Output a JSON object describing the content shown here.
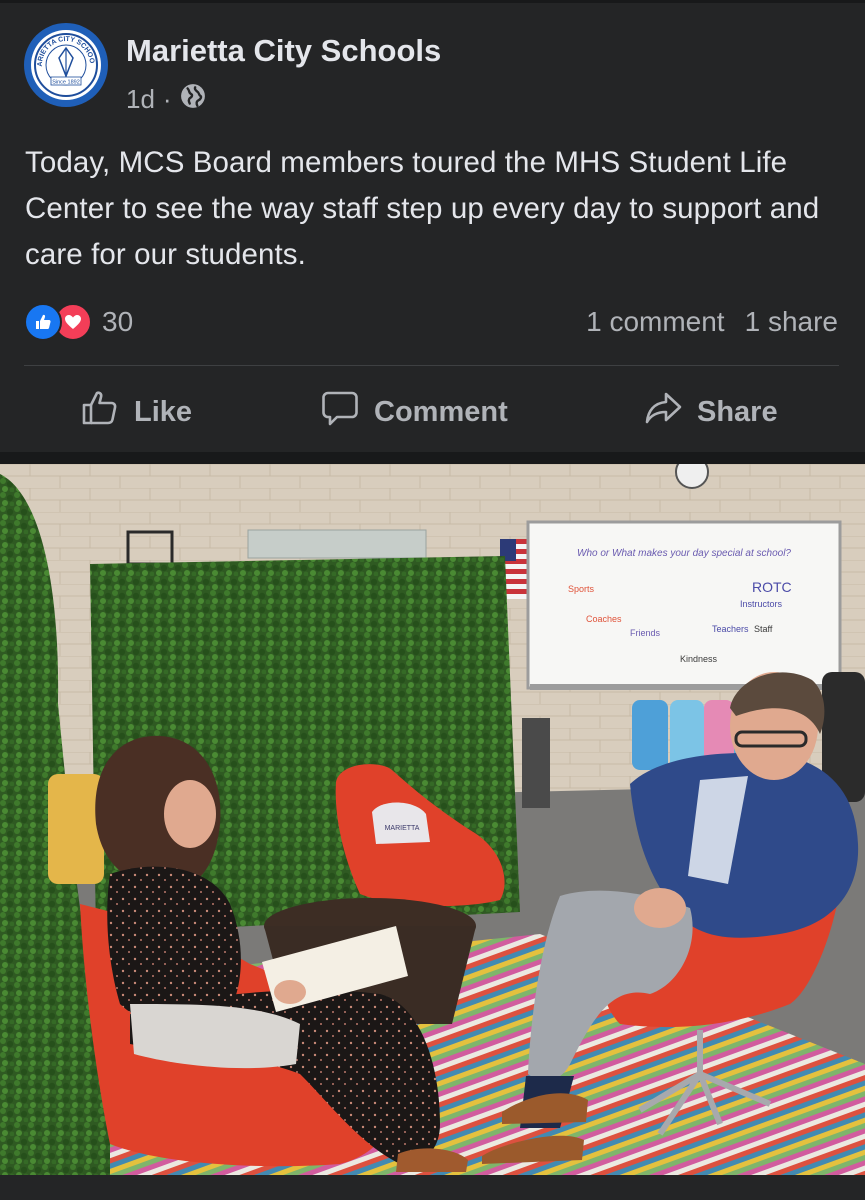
{
  "post": {
    "page_name": "Marietta City Schools",
    "time": "1d",
    "audience_icon": "globe-icon",
    "text": "Today, MCS Board members toured the MHS Student Life Center to see the way staff step up every day to support and care for our students.",
    "avatar": {
      "seal_text_top": "MARIETTA CITY SCHOOLS",
      "seal_text_bottom": "Since 1892"
    },
    "reactions": {
      "icons": [
        "like-icon",
        "love-icon"
      ],
      "count": "30"
    },
    "stats": {
      "comments": "1 comment",
      "shares": "1 share"
    },
    "actions": {
      "like": "Like",
      "comment": "Comment",
      "share": "Share"
    }
  },
  "photo": {
    "whiteboard": {
      "heading": "Who or What makes your day special at school?",
      "items": [
        "ROTC",
        "Instructors",
        "Sports",
        "Coaches",
        "Friends",
        "Teachers",
        "Staff",
        "Kindness"
      ]
    },
    "pillow_text": "MARIETTA"
  },
  "colors": {
    "background": "#242526",
    "text": "#e4e6eb",
    "secondary_text": "#b0b3b8",
    "like_blue": "#1877f2",
    "love_red": "#f33e58",
    "chair_red": "#e0412a"
  }
}
